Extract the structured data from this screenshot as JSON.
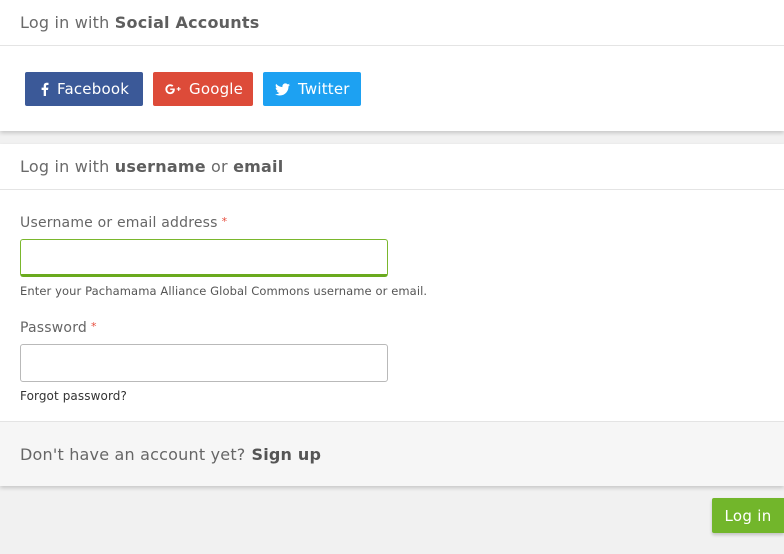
{
  "social": {
    "heading_prefix": "Log in with",
    "heading_bold": "Social Accounts",
    "buttons": [
      {
        "label": "Facebook",
        "icon": "facebook-icon",
        "color": "#3b5998"
      },
      {
        "label": "Google",
        "icon": "google-plus-icon",
        "color": "#dd4b39"
      },
      {
        "label": "Twitter",
        "icon": "twitter-icon",
        "color": "#1da1f2"
      }
    ]
  },
  "login": {
    "heading_prefix": "Log in with",
    "heading_bold1": "username",
    "heading_or": "or",
    "heading_bold2": "email",
    "username_label": "Username or email address",
    "required_mark": "*",
    "username_value": "",
    "username_help": "Enter your Pachamama Alliance Global Commons username or email.",
    "password_label": "Password",
    "password_value": "",
    "forgot_link": "Forgot password?",
    "signup_prompt": "Don't have an account yet?",
    "signup_link": "Sign up",
    "submit_label": "Log in"
  },
  "colors": {
    "accent_green": "#72b62b",
    "required_red": "#e74c3c",
    "page_background": "#f1f1f1"
  }
}
